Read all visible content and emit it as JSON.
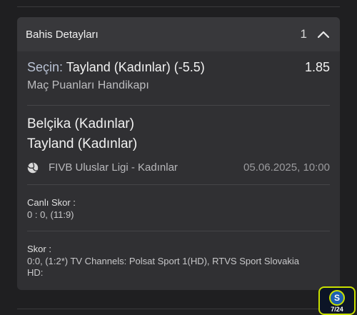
{
  "card": {
    "title": "Bahis Detayları",
    "count": "1"
  },
  "selection": {
    "prefix": "Seçin:",
    "name": "Tayland (Kadınlar) (-5.5)",
    "odds": "1.85",
    "market": "Maç Puanları Handikapı"
  },
  "match": {
    "team_home": "Belçika (Kadınlar)",
    "team_away": "Tayland (Kadınlar)",
    "league": "FIVB Uluslar Ligi - Kadınlar",
    "datetime": "05.06.2025, 10:00"
  },
  "live_score": {
    "label": "Canlı Skor :",
    "value": "0 : 0, (11:9)"
  },
  "score": {
    "label": "Skor :",
    "value": "0:0, (1:2*) TV Channels: Polsat Sport 1(HD), RTVS Sport Slovakia HD:"
  },
  "badge": {
    "label": "7/24",
    "icon_letter": "S"
  },
  "icons": {
    "collapse": "chevron-up-icon",
    "sport": "volleyball-icon"
  },
  "colors": {
    "background": "#1f1f21",
    "card": "#303033",
    "header": "#38383b",
    "badge_accent": "#c9e000"
  }
}
